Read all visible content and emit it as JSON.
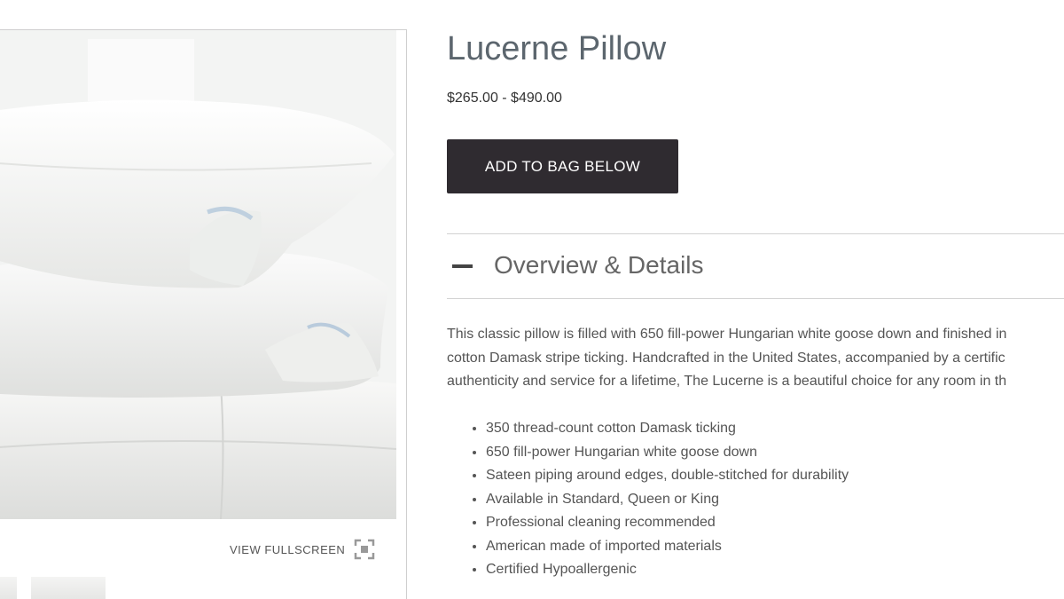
{
  "product": {
    "title": "Lucerne Pillow",
    "price": "$265.00 - $490.00",
    "add_button_label": "ADD TO BAG BELOW"
  },
  "gallery": {
    "fullscreen_label": "VIEW FULLSCREEN",
    "fullscreen_icon": "expand-icon"
  },
  "accordion": {
    "title": "Overview & Details",
    "state_icon": "minus-icon"
  },
  "description": {
    "lines": [
      "This classic pillow is filled with 650 fill-power Hungarian white goose down and finished in",
      "cotton Damask stripe ticking. Handcrafted in the United States, accompanied by a certific",
      "authenticity and service for a lifetime, The Lucerne is a beautiful choice for any room in th"
    ]
  },
  "features": [
    "350 thread-count cotton Damask ticking",
    "650 fill-power Hungarian white goose down",
    "Sateen piping around edges, double-stitched for durability",
    "Available in Standard, Queen or King",
    "Professional cleaning recommended",
    "American made of imported materials",
    "Certified Hypoallergenic"
  ],
  "colors": {
    "button_bg": "#2f2b30",
    "button_text": "#ffffff",
    "title_text": "#5c666e",
    "divider": "#d2d2d2"
  }
}
